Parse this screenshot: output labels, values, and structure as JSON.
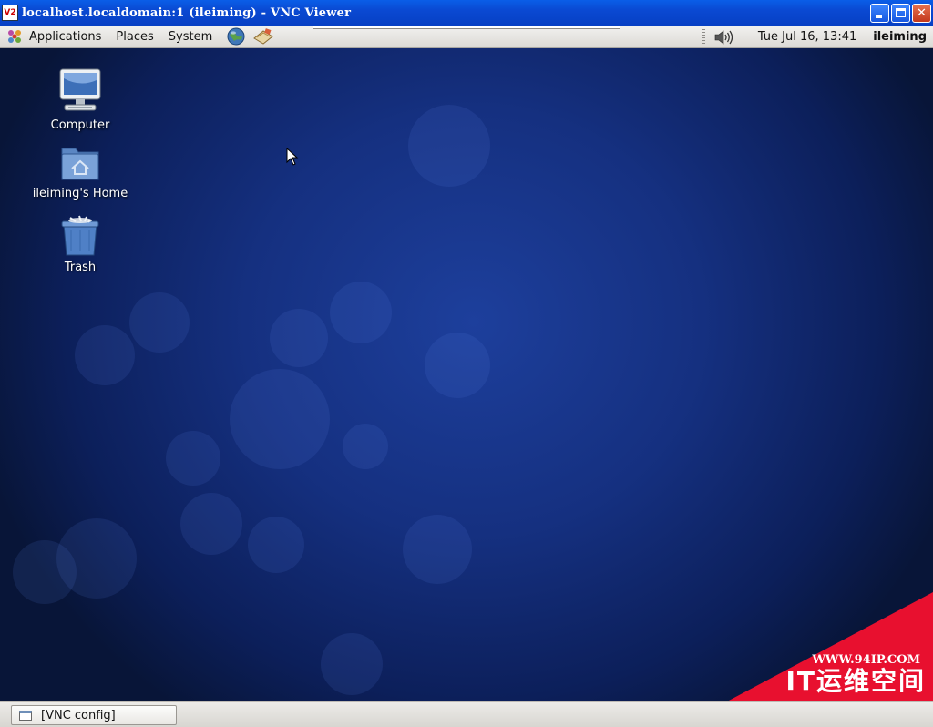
{
  "window": {
    "title": "localhost.localdomain:1 (ileiming) - VNC Viewer",
    "logo_text": "V2",
    "buttons": [
      "minimize-icon",
      "maximize-icon",
      "close-icon"
    ]
  },
  "top_panel": {
    "menus": [
      "Applications",
      "Places",
      "System"
    ],
    "launchers": [
      "web-browser-icon",
      "mail-client-icon"
    ],
    "volume_icon": "speaker-icon",
    "clock": "Tue Jul 16, 13:41",
    "user": "ileiming"
  },
  "desktop": {
    "icons": [
      {
        "label": "Computer",
        "icon": "computer-icon"
      },
      {
        "label": "ileiming's Home",
        "icon": "home-folder-icon"
      },
      {
        "label": "Trash",
        "icon": "trash-icon"
      }
    ]
  },
  "taskbar": {
    "tasks": [
      {
        "label": "[VNC config]",
        "icon": "window-icon"
      }
    ]
  },
  "watermark": {
    "url": "WWW.94IP.COM",
    "brand": "IT运维空间",
    "color": "#e8102f"
  },
  "colors": {
    "titlebar": "#0a49d2",
    "desktop_bg": "#153080",
    "panel_bg": "#e6e4df"
  }
}
